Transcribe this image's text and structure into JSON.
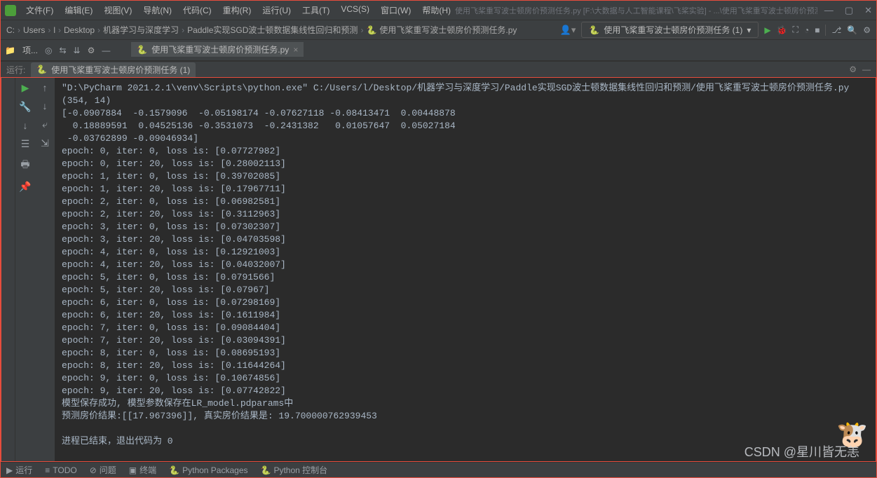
{
  "menu": {
    "file": "文件(F)",
    "edit": "编辑(E)",
    "view": "视图(V)",
    "navigate": "导航(N)",
    "code": "代码(C)",
    "refactor": "重构(R)",
    "run": "运行(U)",
    "tools": "工具(T)",
    "vcs": "VCS(S)",
    "window": "窗口(W)",
    "help": "帮助(H)"
  },
  "title": "使用飞桨重写波士顿房价预测任务.py [F:\\大数据与人工智能课程\\飞桨实验] - ...\\使用飞桨重写波士顿房价预测任务.py",
  "breadcrumb": {
    "root": "C:",
    "users": "Users",
    "l": "l",
    "desktop": "Desktop",
    "ml": "机器学习与深度学习",
    "paddle": "Paddle实现SGD波士顿数据集线性回归和预测",
    "file": "使用飞桨重写波士顿房价预测任务.py"
  },
  "run_config": "使用飞桨重写波士顿房价预测任务 (1)",
  "toolbar": {
    "project": "项..."
  },
  "editor_tab": "使用飞桨重写波士顿房价预测任务.py",
  "run": {
    "label": "运行:",
    "tab": "使用飞桨重写波士顿房价预测任务 (1)"
  },
  "console": {
    "cmd": "\"D:\\PyCharm 2021.2.1\\venv\\Scripts\\python.exe\" C:/Users/l/Desktop/机器学习与深度学习/Paddle实现SGD波士顿数据集线性回归和预测/使用飞桨重写波士顿房价预测任务.py",
    "shape": "(354, 14)",
    "arr1": "[-0.0907884  -0.1579096  -0.05198174 -0.07627118 -0.08413471  0.00448878",
    "arr2": "  0.18889591  0.04525136 -0.3531073  -0.2431382   0.01057647  0.05027184",
    "arr3": " -0.03762899 -0.09046934]",
    "epochs": [
      "epoch: 0, iter: 0, loss is: [0.07727982]",
      "epoch: 0, iter: 20, loss is: [0.28002113]",
      "epoch: 1, iter: 0, loss is: [0.39702085]",
      "epoch: 1, iter: 20, loss is: [0.17967711]",
      "epoch: 2, iter: 0, loss is: [0.06982581]",
      "epoch: 2, iter: 20, loss is: [0.3112963]",
      "epoch: 3, iter: 0, loss is: [0.07302307]",
      "epoch: 3, iter: 20, loss is: [0.04703598]",
      "epoch: 4, iter: 0, loss is: [0.12921003]",
      "epoch: 4, iter: 20, loss is: [0.04032007]",
      "epoch: 5, iter: 0, loss is: [0.0791566]",
      "epoch: 5, iter: 20, loss is: [0.07967]",
      "epoch: 6, iter: 0, loss is: [0.07298169]",
      "epoch: 6, iter: 20, loss is: [0.1611984]",
      "epoch: 7, iter: 0, loss is: [0.09084404]",
      "epoch: 7, iter: 20, loss is: [0.03094391]",
      "epoch: 8, iter: 0, loss is: [0.08695193]",
      "epoch: 8, iter: 20, loss is: [0.11644264]",
      "epoch: 9, iter: 0, loss is: [0.10674856]",
      "epoch: 9, iter: 20, loss is: [0.07742822]"
    ],
    "saved": "模型保存成功, 模型参数保存在LR_model.pdparams中",
    "predict": "预测房价结果:[[17.967396]], 真实房价结果是: 19.700000762939453",
    "exit": "进程已结束，退出代码为 0"
  },
  "bottom": {
    "run": "运行",
    "todo": "TODO",
    "problem": "问题",
    "terminal": "终端",
    "packages": "Python Packages",
    "console": "Python 控制台"
  },
  "watermark": "CSDN @星川皆无恙"
}
